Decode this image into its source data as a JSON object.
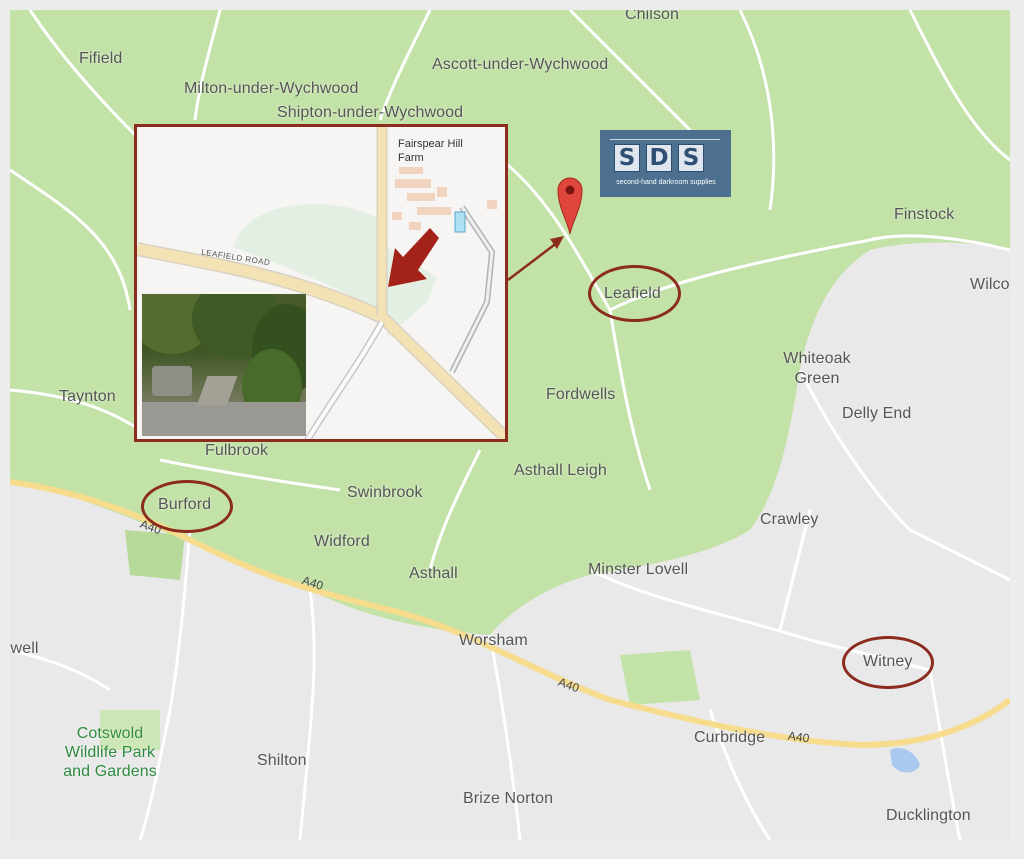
{
  "map": {
    "places": [
      {
        "id": "chilson",
        "label": "Chilson"
      },
      {
        "id": "fifield",
        "label": "Fifield"
      },
      {
        "id": "ascott",
        "label": "Ascott-under-Wychwood"
      },
      {
        "id": "milton",
        "label": "Milton-under-Wychwood"
      },
      {
        "id": "shipton",
        "label": "Shipton-under-Wychwood"
      },
      {
        "id": "finstock",
        "label": "Finstock"
      },
      {
        "id": "wilcote",
        "label": "Wilco"
      },
      {
        "id": "leafield",
        "label": "Leafield"
      },
      {
        "id": "whiteoak",
        "label": "Whiteoak Green"
      },
      {
        "id": "taynton",
        "label": "Taynton"
      },
      {
        "id": "fordwells",
        "label": "Fordwells"
      },
      {
        "id": "dellyend",
        "label": "Delly End"
      },
      {
        "id": "fulbrook",
        "label": "Fulbrook"
      },
      {
        "id": "asthallleigh",
        "label": "Asthall Leigh"
      },
      {
        "id": "burford",
        "label": "Burford"
      },
      {
        "id": "swinbrook",
        "label": "Swinbrook"
      },
      {
        "id": "crawley",
        "label": "Crawley"
      },
      {
        "id": "widford",
        "label": "Widford"
      },
      {
        "id": "asthall",
        "label": "Asthall"
      },
      {
        "id": "minsterlovell",
        "label": "Minster Lovell"
      },
      {
        "id": "worsham",
        "label": "Worsham"
      },
      {
        "id": "twell",
        "label": "twell"
      },
      {
        "id": "witney",
        "label": "Witney"
      },
      {
        "id": "cotswold",
        "label": "Cotswold Wildlife Park and Gardens"
      },
      {
        "id": "curbridge",
        "label": "Curbridge"
      },
      {
        "id": "shilton",
        "label": "Shilton"
      },
      {
        "id": "brizenorton",
        "label": "Brize Norton"
      },
      {
        "id": "ducklington",
        "label": "Ducklington"
      }
    ],
    "road_labels": [
      "A40",
      "A40",
      "A40",
      "A40"
    ],
    "highlighted": [
      "Leafield",
      "Burford",
      "Witney"
    ],
    "colors": {
      "land": "#e9e9e9",
      "forest": "#c3e2a8",
      "road": "#ffffff",
      "major_road": "#f6dc8c",
      "circle": "#8b2c1f",
      "pin": "#e0463b"
    }
  },
  "inset": {
    "farm_label": "Fairspear Hill Farm",
    "road_label": "LEAFIELD ROAD"
  },
  "logo": {
    "letters": [
      "S",
      "D",
      "S"
    ],
    "tagline": "second-hand darkroom supplies",
    "color": "#4d7090"
  },
  "pin_icon": "map-pin-icon"
}
